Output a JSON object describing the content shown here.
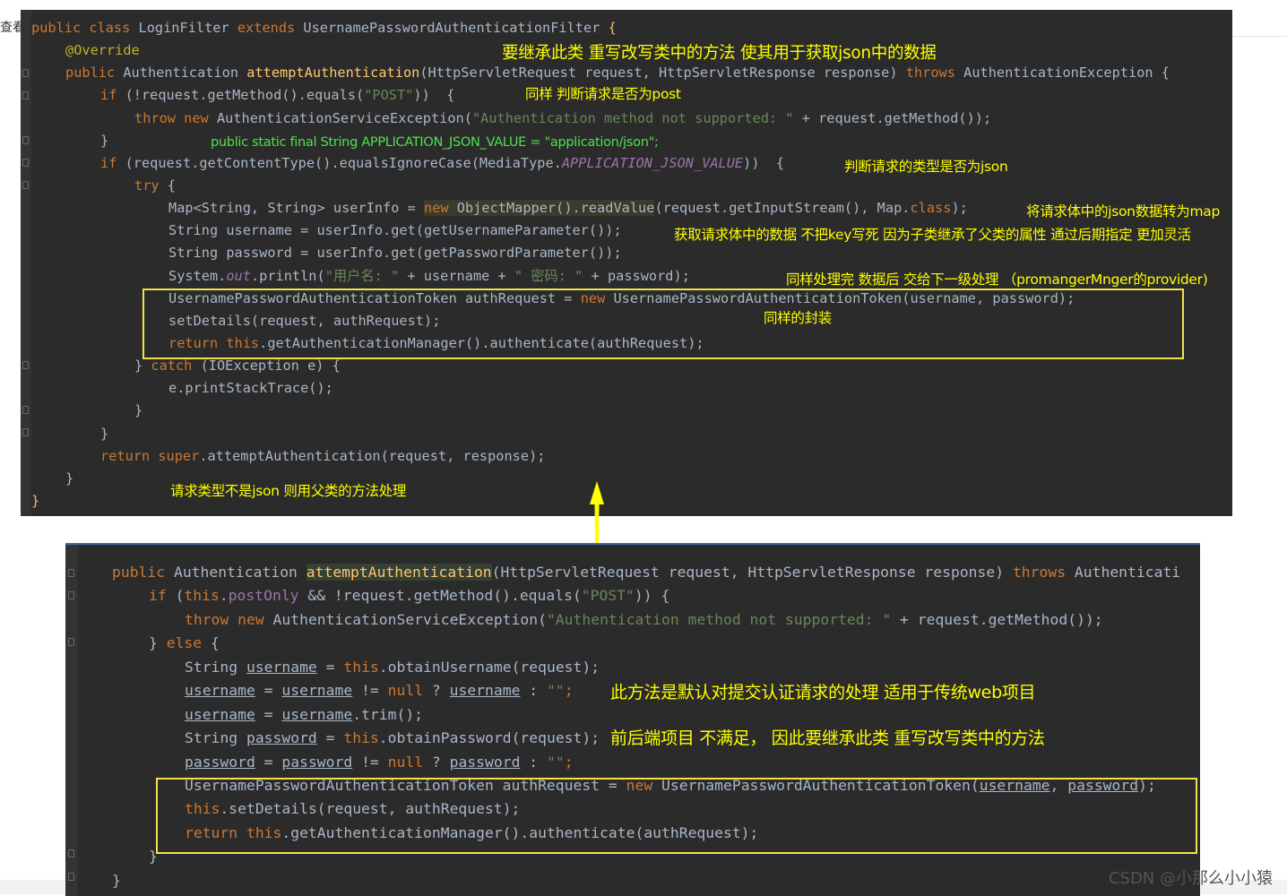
{
  "left_fragment": "查看",
  "top_panel": {
    "lines": [
      [
        [
          "kw",
          "public class "
        ],
        [
          "",
          "LoginFilter "
        ],
        [
          "kw",
          "extends "
        ],
        [
          "",
          "UsernamePasswordAuthenticationFilter "
        ],
        [
          "gold",
          "{"
        ]
      ],
      [
        [
          "ann",
          "@Override"
        ]
      ],
      [
        [
          "kw",
          "public "
        ],
        [
          "",
          "Authentication "
        ],
        [
          "fn",
          "attemptAuthentication"
        ],
        [
          "",
          "(HttpServletRequest request, HttpServletResponse response) "
        ],
        [
          "kw",
          "throws "
        ],
        [
          "",
          "AuthenticationException {"
        ]
      ],
      [
        [
          "kw",
          "if "
        ],
        [
          "",
          "(!request.getMethod().equals("
        ],
        [
          "str",
          "\"POST\""
        ],
        [
          "",
          "))  {"
        ]
      ],
      [
        [
          "kw",
          "throw new "
        ],
        [
          "",
          "AuthenticationServiceException("
        ],
        [
          "str",
          "\"Authentication method not supported: \" "
        ],
        [
          "",
          "+ request.getMethod());"
        ]
      ],
      [
        [
          "",
          "}"
        ]
      ],
      [
        [
          "kw",
          "if "
        ],
        [
          "",
          "(request.getContentType().equalsIgnoreCase(MediaType."
        ],
        [
          "fld",
          "APPLICATION_JSON_VALUE"
        ],
        [
          "",
          "))  {"
        ]
      ],
      [
        [
          "kw",
          "try "
        ],
        [
          "",
          "{"
        ]
      ],
      [
        [
          "",
          "Map<String, String> userInfo = "
        ],
        [
          "hlkw",
          "new "
        ],
        [
          "hl",
          "ObjectMapper().readValue"
        ],
        [
          "",
          "(request.getInputStream(), Map."
        ],
        [
          "kw",
          "class"
        ],
        [
          "",
          ");"
        ]
      ],
      [
        [
          "",
          "String username = userInfo.get(getUsernameParameter());"
        ]
      ],
      [
        [
          "",
          "String password = userInfo.get(getPasswordParameter());"
        ]
      ],
      [
        [
          "",
          "System."
        ],
        [
          "fld",
          "out"
        ],
        [
          "",
          ".println("
        ],
        [
          "str",
          "\"用户名: \" "
        ],
        [
          "",
          "+ username + "
        ],
        [
          "str",
          "\" 密码: \" "
        ],
        [
          "",
          "+ password);"
        ]
      ],
      [
        [
          "",
          "UsernamePasswordAuthenticationToken authRequest = "
        ],
        [
          "kw",
          "new "
        ],
        [
          "",
          "UsernamePasswordAuthenticationToken(username, password);"
        ]
      ],
      [
        [
          "",
          "setDetails(request, authRequest);"
        ]
      ],
      [
        [
          "kw",
          "return this"
        ],
        [
          "",
          ".getAuthenticationManager().authenticate(authRequest);"
        ]
      ],
      [
        [
          "",
          "} "
        ],
        [
          "kw",
          "catch "
        ],
        [
          "",
          "(IOException e) {"
        ]
      ],
      [
        [
          "",
          "e.printStackTrace();"
        ]
      ],
      [
        [
          "",
          "}"
        ]
      ],
      [
        [
          "",
          "}"
        ]
      ],
      [
        [
          "kw",
          "return super"
        ],
        [
          "",
          ".attemptAuthentication(request, response);"
        ]
      ],
      [
        [
          "",
          "}"
        ]
      ],
      [
        [
          "gold",
          "}"
        ]
      ]
    ]
  },
  "top_notes": [
    "要继承此类 重写改写类中的方法 使其用于获取json中的数据",
    "同样 判断请求是否为post",
    "public static final String APPLICATION_JSON_VALUE = \"application/json\";",
    "判断请求的类型是否为json",
    "将请求体中的json数据转为map",
    "获取请求体中的数据   不把key写死  因为子类继承了父类的属性 通过后期指定 更加灵活",
    "同样处理完 数据后 交给下一级处理 （promangerMnger的provider)",
    "同样的封装",
    "请求类型不是json 则用父类的方法处理"
  ],
  "bottom_panel": {
    "lines": [
      [
        [
          "kw",
          "public "
        ],
        [
          "",
          "Authentication "
        ],
        [
          "fnhl",
          "attemptAuthentication"
        ],
        [
          "",
          "(HttpServletRequest request, HttpServletResponse response) "
        ],
        [
          "kw",
          "throws "
        ],
        [
          "",
          "Authenticati"
        ]
      ],
      [
        [
          "kw",
          "if "
        ],
        [
          "",
          "("
        ],
        [
          "kw",
          "this"
        ],
        [
          "",
          "."
        ],
        [
          "fld2",
          "postOnly "
        ],
        [
          "",
          "&& !request.getMethod().equals("
        ],
        [
          "str",
          "\"POST\""
        ],
        [
          "",
          ")) {"
        ]
      ],
      [
        [
          "kw",
          "throw new "
        ],
        [
          "",
          "AuthenticationServiceException("
        ],
        [
          "str",
          "\"Authentication method not supported: \" "
        ],
        [
          "",
          "+ request.getMethod());"
        ]
      ],
      [
        [
          "",
          "} "
        ],
        [
          "kw",
          "else "
        ],
        [
          "",
          "{"
        ]
      ],
      [
        [
          "",
          "String "
        ],
        [
          "u",
          "username"
        ],
        [
          "",
          " = "
        ],
        [
          "kw",
          "this"
        ],
        [
          "",
          ".obtainUsername(request);"
        ]
      ],
      [
        [
          "u",
          "username"
        ],
        [
          "",
          " = "
        ],
        [
          "u",
          "username"
        ],
        [
          "",
          " != "
        ],
        [
          "kw",
          "null "
        ],
        [
          "",
          "? "
        ],
        [
          "u",
          "username"
        ],
        [
          "",
          " : "
        ],
        [
          "str",
          "\"\""
        ],
        [
          "kw",
          ";"
        ]
      ],
      [
        [
          "u",
          "username"
        ],
        [
          "",
          " = "
        ],
        [
          "u",
          "username"
        ],
        [
          "",
          ".trim();"
        ]
      ],
      [
        [
          "",
          "String "
        ],
        [
          "u",
          "password"
        ],
        [
          "",
          " = "
        ],
        [
          "kw",
          "this"
        ],
        [
          "",
          ".obtainPassword(request);"
        ]
      ],
      [
        [
          "u",
          "password"
        ],
        [
          "",
          " = "
        ],
        [
          "u",
          "password"
        ],
        [
          "",
          " != "
        ],
        [
          "kw",
          "null "
        ],
        [
          "",
          "? "
        ],
        [
          "u",
          "password"
        ],
        [
          "",
          " : "
        ],
        [
          "str",
          "\"\""
        ],
        [
          "kw",
          ";"
        ]
      ],
      [
        [
          "",
          "UsernamePasswordAuthenticationToken authRequest = "
        ],
        [
          "kw",
          "new "
        ],
        [
          "",
          "UsernamePasswordAuthenticationToken("
        ],
        [
          "u",
          "username"
        ],
        [
          "",
          ", "
        ],
        [
          "u",
          "password"
        ],
        [
          "",
          ");"
        ]
      ],
      [
        [
          "kw",
          "this"
        ],
        [
          "",
          ".setDetails(request, authRequest);"
        ]
      ],
      [
        [
          "kw",
          "return this"
        ],
        [
          "",
          ".getAuthenticationManager().authenticate(authRequest);"
        ]
      ],
      [
        [
          "",
          "}"
        ]
      ],
      [
        [
          "",
          "}"
        ]
      ]
    ]
  },
  "bottom_notes": [
    "此方法是默认对提交认证请求的处理  适用于传统web项目",
    "前后端项目 不满足， 因此要继承此类 重写改写类中的方法"
  ],
  "watermark": "CSDN @小那么小小猿",
  "colors": {
    "editor_bg": "#2b2b2b",
    "keyword": "#cc7832",
    "string": "#6a8759",
    "method": "#ffc66d",
    "annotation_text": "#ffff00",
    "highlight_box": "#f2e24a",
    "green_note": "#4be34b"
  }
}
